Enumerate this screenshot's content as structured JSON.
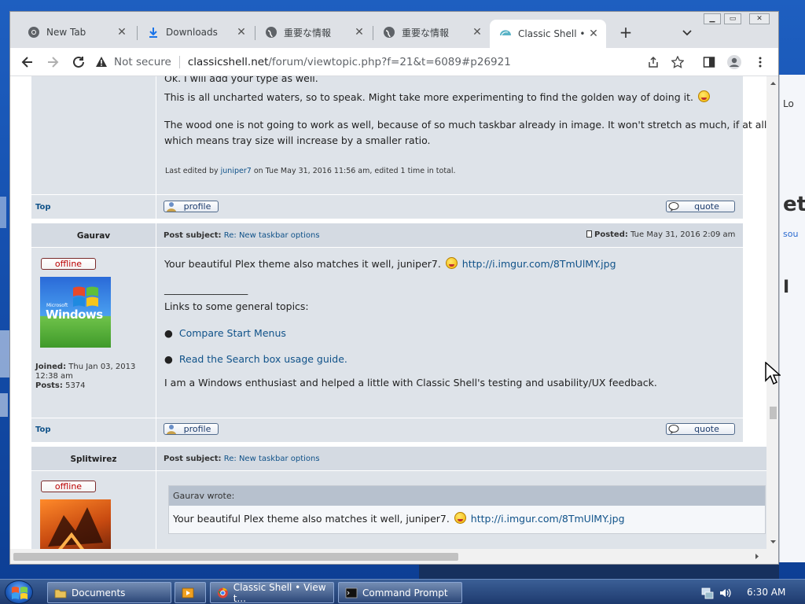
{
  "browser": {
    "tabs": [
      {
        "label": "New Tab",
        "icon": "chrome-icon"
      },
      {
        "label": "Downloads",
        "icon": "download-icon"
      },
      {
        "label": "重要な情報",
        "icon": "globe-icon"
      },
      {
        "label": "重要な情報",
        "icon": "globe-icon"
      },
      {
        "label": "Classic Shell • View topic",
        "icon": "classic-shell-icon"
      }
    ],
    "address": {
      "security": "Not secure",
      "host": "classicshell.net",
      "path": "/forum/viewtopic.php?f=21&t=6089#p26921"
    },
    "new_tab": "+"
  },
  "post1": {
    "line1": "Ok. I will add your type as well.",
    "line2": "This is all uncharted waters, so to speak. Might take more experimenting to find the golden way of doing it.",
    "line3": "The wood one is not going to work as well, because of so much taskbar already in image. It won't stretch as much, if at all,",
    "line4": "which means tray size will increase by a smaller ratio.",
    "edit_prefix": "Last edited by",
    "edit_user": "juniper7",
    "edit_suffix": "on Tue May 31, 2016 11:56 am, edited 1 time in total."
  },
  "post2": {
    "author": "Gaurav",
    "status": "offline",
    "avatar_text": "Windows",
    "avatar_small": "Microsoft",
    "joined_label": "Joined:",
    "joined": "Thu Jan 03, 2013 12:38 am",
    "joined_line1": "Thu Jan 03, 2013",
    "joined_line2": "12:38 am",
    "posts_label": "Posts:",
    "posts": "5374",
    "subject_label": "Post subject:",
    "subject": "Re: New taskbar options",
    "posted_label": "Posted:",
    "posted": "Tue May 31, 2016 2:09 am",
    "text": "Your beautiful Plex theme also matches it well, juniper7.",
    "link": "http://i.imgur.com/8TmUlMY.jpg",
    "sig_line": "_________________",
    "sig_intro": "Links to some general topics:",
    "sig_links": [
      "Compare Start Menus",
      "Read the Search box usage guide."
    ],
    "sig_text": "I am a Windows enthusiast and helped a little with Classic Shell's testing and usability/UX feedback."
  },
  "post3": {
    "author": "Splitwirez",
    "status": "offline",
    "subject_label": "Post subject:",
    "subject": "Re: New taskbar options",
    "quote_header": "Gaurav wrote:",
    "quote_text": "Your beautiful Plex theme also matches it well, juniper7.",
    "quote_link": "http://i.imgur.com/8TmUlMY.jpg"
  },
  "buttons": {
    "top": "Top",
    "profile": "profile",
    "quote": "quote"
  },
  "taskbar": {
    "items": [
      "Documents",
      "Classic Shell • View t...",
      "Command Prompt"
    ],
    "clock": "6:30 AM"
  },
  "colors": {
    "post_bg": "#dee3e9",
    "link": "#105289",
    "offline": "#bb0000"
  }
}
